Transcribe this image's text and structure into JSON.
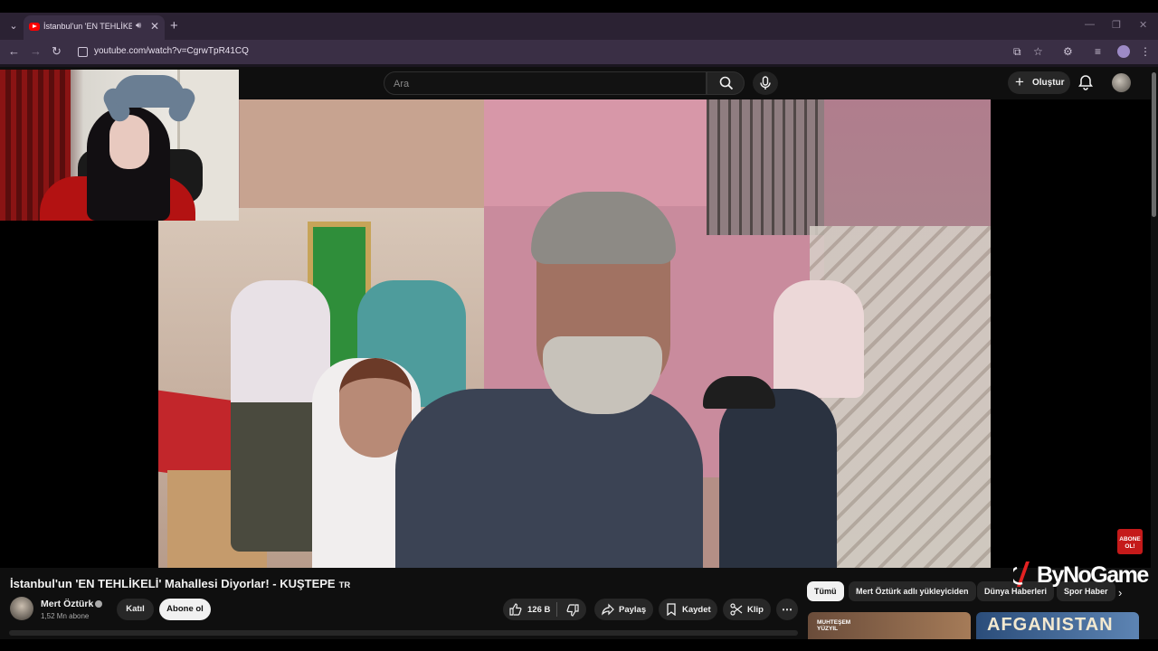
{
  "browser": {
    "tab_title": "İstanbul'un 'EN TEHLİKELİ' M",
    "url": "youtube.com/watch?v=CgrwTpR41CQ"
  },
  "youtube": {
    "search_placeholder": "Ara",
    "create_label": "Oluştur"
  },
  "overlay": {
    "badge_line1": "ABONE",
    "badge_line2": "OL!"
  },
  "video": {
    "title": "İstanbul'un 'EN TEHLİKELİ' Mahallesi Diyorlar! - KUŞTEPE",
    "title_flag": "TR",
    "channel_name": "Mert Öztürk",
    "subscribers": "1,52 Mn abone",
    "join_label": "Katıl",
    "subscribe_label": "Abone ol",
    "likes": "126 B",
    "share_label": "Paylaş",
    "save_label": "Kaydet",
    "clip_label": "Klip"
  },
  "recommendations": {
    "chips": [
      "Tümü",
      "Mert Öztürk adlı yükleyiciden",
      "Dünya Haberleri",
      "Spor Haber"
    ],
    "thumb1_text": "MUHTEŞEM YÜZYIL",
    "thumb2_text": "AFGANISTAN"
  },
  "watermark": {
    "text": "ByNoGame"
  },
  "colors": {
    "background": "#0f0f0f",
    "tab_bar": "#2b2233",
    "address_bar": "#3a2f45",
    "youtube_red": "#ff0000",
    "pill": "#272727"
  }
}
